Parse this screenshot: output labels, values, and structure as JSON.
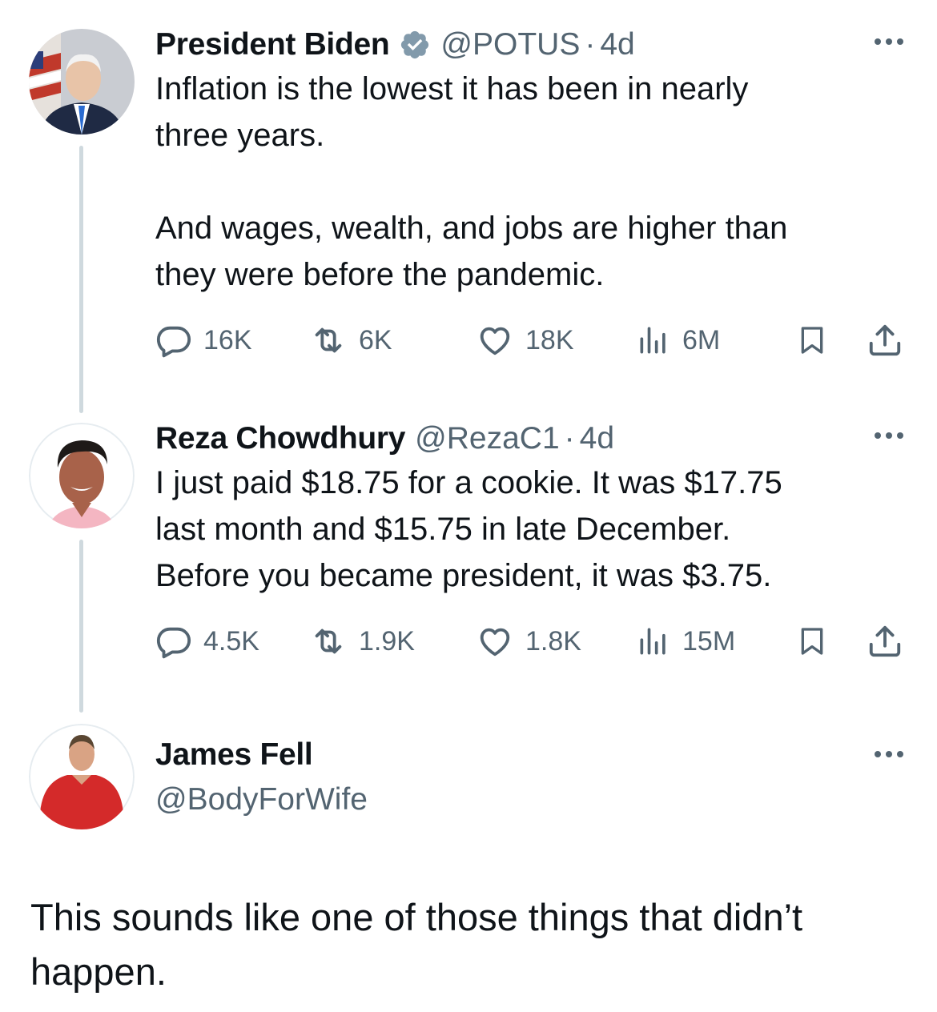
{
  "tweets": [
    {
      "name": "President Biden",
      "verified": true,
      "handle": "@POTUS",
      "separator": "·",
      "time": "4d",
      "text": "Inflation is the lowest it has been in nearly\nthree years.\n\nAnd wages, wealth, and jobs are higher than\nthey were before the pandemic.",
      "stats": {
        "replies": "16K",
        "reposts": "6K",
        "likes": "18K",
        "views": "6M"
      }
    },
    {
      "name": "Reza Chowdhury",
      "verified": false,
      "handle": "@RezaC1",
      "separator": "·",
      "time": "4d",
      "text": "I just paid $18.75 for a cookie. It was $17.75\nlast month and $15.75 in late December.\nBefore you became president, it was $3.75.",
      "stats": {
        "replies": "4.5K",
        "reposts": "1.9K",
        "likes": "1.8K",
        "views": "15M"
      }
    }
  ],
  "reply": {
    "name": "James Fell",
    "handle": "@BodyForWife",
    "text": "This sounds like one of those things that didn’t happen."
  },
  "icons": {
    "reply": "reply-icon",
    "repost": "repost-icon",
    "like": "heart-icon",
    "views": "views-icon",
    "bookmark": "bookmark-icon",
    "share": "share-icon",
    "more": "more-icon",
    "verified": "verified-badge-icon"
  },
  "colors": {
    "text": "#0f1419",
    "secondary": "#536471",
    "thread_line": "#cfd9de",
    "verified_badge": "#829aab"
  }
}
